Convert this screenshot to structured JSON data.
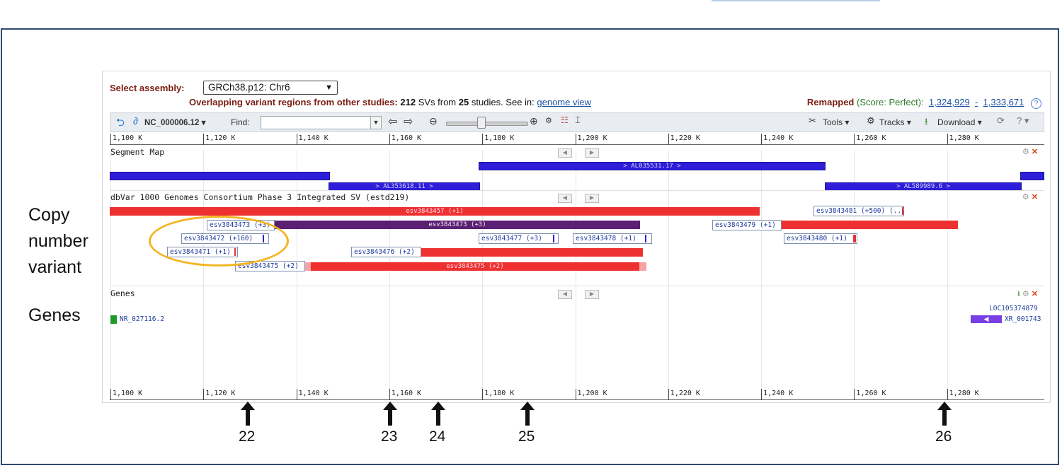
{
  "side_labels": {
    "cnv_line1": "Copy",
    "cnv_line2": "number",
    "cnv_line3": "variant",
    "genes": "Genes"
  },
  "header": {
    "assembly_label": "Select assembly:",
    "assembly_value": "GRCh38.p12: Chr6",
    "overlap_prefix": "Overlapping variant regions from other studies:",
    "overlap_count": "212",
    "overlap_mid": "SVs from",
    "overlap_studies": "25",
    "overlap_suffix": "studies. See in:",
    "overlap_link": "genome view",
    "remapped_label": "Remapped",
    "remapped_score": "(Score: Perfect):",
    "remap_start": "1,324,929",
    "remap_dash": "-",
    "remap_end": "1,333,671",
    "help_glyph": "?"
  },
  "toolbar": {
    "sequence": "NC_000006.12",
    "find_label": "Find:",
    "find_value": "",
    "tools": "Tools",
    "tracks": "Tracks",
    "download": "Download"
  },
  "ruler_ticks": [
    "1,100 K",
    "1,120 K",
    "1,140 K",
    "1,160 K",
    "1,180 K",
    "1,200 K",
    "1,220 K",
    "1,240 K",
    "1,260 K",
    "1,280 K"
  ],
  "tracks": {
    "segment_map": "Segment Map",
    "dbvar": "dbVar 1000 Genomes Consortium Phase 3 Integrated SV (estd219)",
    "genes": "Genes"
  },
  "segments": {
    "al0355": "> AL035531.17 >",
    "al3536": "> AL353618.11 >",
    "al5899": "> AL589989.6 >"
  },
  "variants": {
    "v3457": "esv3843457 (+1)",
    "v3481": "esv3843481 (+500) (...",
    "v3473_tag": "esv3843473 (+3)",
    "v3473_bar": "esv3843473 (+3)",
    "v3479": "esv3843479 (+1)",
    "v3472": "esv3843472 (+160)",
    "v3477": "esv3843477 (+3)",
    "v3478": "esv3843478 (+1)",
    "v3480": "esv3843480 (+1)",
    "v3471": "esv3843471 (+1)",
    "v3476": "esv3843476 (+2)",
    "v3475_tag": "esv3843475 (+2)",
    "v3475_bar": "esv3843475 (+2)"
  },
  "genes": {
    "nr027116": "NR_027116.2",
    "loc105374879": "LOC105374879",
    "xr001743": "XR_001743"
  },
  "arrows": [
    "22",
    "23",
    "24",
    "25",
    "26"
  ],
  "colors": {
    "segment_blue": "#2e1ed9",
    "variant_red": "#ee3030",
    "variant_purple": "#5b1f74",
    "highlight": "#f4b521",
    "frame": "#2e4a6e"
  }
}
